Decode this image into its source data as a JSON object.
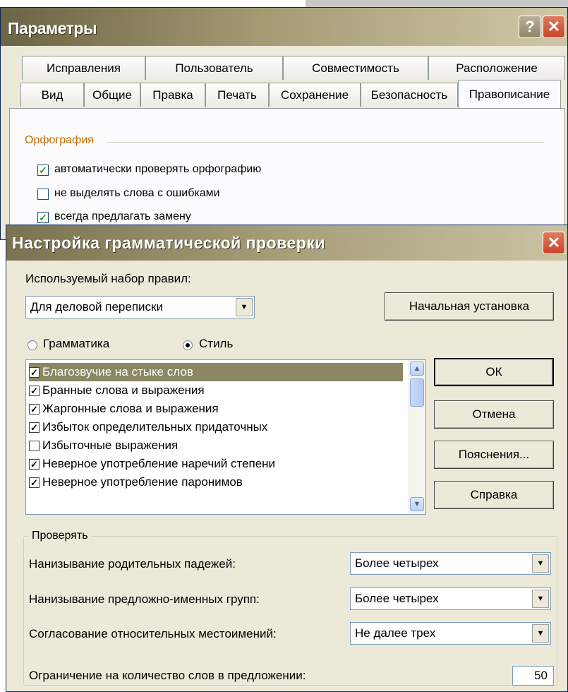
{
  "dialog1": {
    "title": "Параметры",
    "help_glyph": "?",
    "close_glyph": "✕",
    "tabs_row1": [
      "Исправления",
      "Пользователь",
      "Совместимость",
      "Расположение"
    ],
    "tabs_row2": [
      "Вид",
      "Общие",
      "Правка",
      "Печать",
      "Сохранение",
      "Безопасность",
      "Правописание"
    ],
    "active_tab": "Правописание",
    "group_title": "Орфография",
    "checkboxes": [
      {
        "label": "автоматически проверять орфографию",
        "checked": true
      },
      {
        "label": "не выделять слова с ошибками",
        "checked": false
      },
      {
        "label": "всегда предлагать замену",
        "checked": true
      }
    ]
  },
  "dialog2": {
    "title": "Настройка грамматической проверки",
    "close_glyph": "✕",
    "ruleset_label": "Используемый набор правил:",
    "ruleset_value": "Для деловой переписки",
    "reset_button": "Начальная установка",
    "radio_grammar": "Грамматика",
    "radio_style": "Стиль",
    "radio_selected": "Стиль",
    "rules": [
      {
        "label": "Благозвучие на стыке слов",
        "checked": true,
        "selected": true
      },
      {
        "label": "Бранные слова и выражения",
        "checked": true,
        "selected": false
      },
      {
        "label": "Жаргонные слова и выражения",
        "checked": true,
        "selected": false
      },
      {
        "label": "Избыток определительных придаточных",
        "checked": true,
        "selected": false
      },
      {
        "label": "Избыточные выражения",
        "checked": false,
        "selected": false
      },
      {
        "label": "Неверное употребление наречий степени",
        "checked": true,
        "selected": false
      },
      {
        "label": "Неверное употребление паронимов",
        "checked": true,
        "selected": false
      }
    ],
    "ok_button": "ОК",
    "cancel_button": "Отмена",
    "explain_button": "Пояснения...",
    "help_button": "Справка",
    "check_group_title": "Проверять",
    "check_rows": [
      {
        "label": "Нанизывание родительных падежей:",
        "value": "Более четырех"
      },
      {
        "label": "Нанизывание предложно-именных групп:",
        "value": "Более четырех"
      },
      {
        "label": "Согласование относительных местоимений:",
        "value": "Не далее трех"
      }
    ],
    "word_limit_label": "Ограничение на количество слов в предложении:",
    "word_limit_value": "50"
  }
}
